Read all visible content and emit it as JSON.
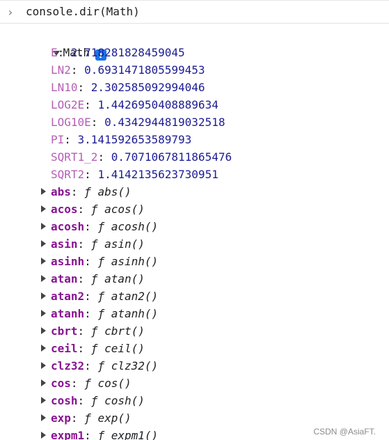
{
  "console": {
    "prompt_icon": "›",
    "command": "console.dir(Math)"
  },
  "root": {
    "label": "Math",
    "info_icon": "i"
  },
  "properties": [
    {
      "key": "E",
      "value": "2.718281828459045"
    },
    {
      "key": "LN2",
      "value": "0.6931471805599453"
    },
    {
      "key": "LN10",
      "value": "2.302585092994046"
    },
    {
      "key": "LOG2E",
      "value": "1.4426950408889634"
    },
    {
      "key": "LOG10E",
      "value": "0.4342944819032518"
    },
    {
      "key": "PI",
      "value": "3.141592653589793"
    },
    {
      "key": "SQRT1_2",
      "value": "0.7071067811865476"
    },
    {
      "key": "SQRT2",
      "value": "1.4142135623730951"
    }
  ],
  "functions": [
    {
      "key": "abs",
      "display": "abs()"
    },
    {
      "key": "acos",
      "display": "acos()"
    },
    {
      "key": "acosh",
      "display": "acosh()"
    },
    {
      "key": "asin",
      "display": "asin()"
    },
    {
      "key": "asinh",
      "display": "asinh()"
    },
    {
      "key": "atan",
      "display": "atan()"
    },
    {
      "key": "atan2",
      "display": "atan2()"
    },
    {
      "key": "atanh",
      "display": "atanh()"
    },
    {
      "key": "cbrt",
      "display": "cbrt()"
    },
    {
      "key": "ceil",
      "display": "ceil()"
    },
    {
      "key": "clz32",
      "display": "clz32()"
    },
    {
      "key": "cos",
      "display": "cos()"
    },
    {
      "key": "cosh",
      "display": "cosh()"
    },
    {
      "key": "exp",
      "display": "exp()"
    },
    {
      "key": "expm1",
      "display": "expm1()"
    }
  ],
  "function_symbol": "ƒ",
  "watermark": "CSDN @AsiaFT.",
  "colors": {
    "key_color": "#881391",
    "number_color": "#1c1c94",
    "info_icon_bg": "#1a73e8"
  }
}
